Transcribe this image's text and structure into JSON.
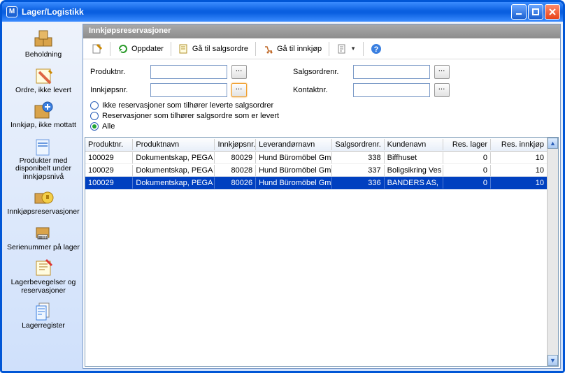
{
  "window": {
    "title": "Lager/Logistikk",
    "app_icon_letter": "M"
  },
  "sidebar": {
    "items": [
      {
        "label": "Beholdning"
      },
      {
        "label": "Ordre, ikke levert"
      },
      {
        "label": "Innkjøp, ikke mottatt"
      },
      {
        "label": "Produkter med disponibelt under innkjøpsnivå"
      },
      {
        "label": "Innkjøpsreservasjoner"
      },
      {
        "label": "Serienummer på lager"
      },
      {
        "label": "Lagerbevegelser og reservasjoner"
      },
      {
        "label": "Lagerregister"
      }
    ]
  },
  "panel": {
    "title": "Innkjøpsreservasjoner"
  },
  "toolbar": {
    "refresh_label": "Oppdater",
    "goto_salesorder_label": "Gå til salgsordre",
    "goto_purchase_label": "Gå til innkjøp"
  },
  "filters": {
    "produktnr_label": "Produktnr.",
    "innkjopsnr_label": "Innkjøpsnr.",
    "salgsordrenr_label": "Salgsordrenr.",
    "kontaktnr_label": "Kontaktnr.",
    "produktnr_value": "",
    "innkjopsnr_value": "",
    "salgsordrenr_value": "",
    "kontaktnr_value": "",
    "radio1": "Ikke reservasjoner som tilhører leverte salgsordrer",
    "radio2": "Reservasjoner som tilhører salgsordre som er levert",
    "radio3": "Alle",
    "selected_radio": 3
  },
  "grid": {
    "headers": {
      "produktnr": "Produktnr.",
      "produktnavn": "Produktnavn",
      "innkjopsnr": "Innkjøpsnr.",
      "leverandornavn": "Leverandørnavn",
      "salgsordrenr": "Salgsordrenr.",
      "kundenavn": "Kundenavn",
      "reslager": "Res. lager",
      "resinnkjop": "Res. innkjøp"
    },
    "rows": [
      {
        "produktnr": "100029",
        "produktnavn": "Dokumentskap, PEGA",
        "innkjopsnr": "80029",
        "leverandornavn": "Hund Büromöbel Gm",
        "salgsordrenr": "338",
        "kundenavn": "Biffhuset",
        "reslager": "0",
        "resinnkjop": "10",
        "selected": false
      },
      {
        "produktnr": "100029",
        "produktnavn": "Dokumentskap, PEGA",
        "innkjopsnr": "80028",
        "leverandornavn": "Hund Büromöbel Gm",
        "salgsordrenr": "337",
        "kundenavn": "Boligsikring Ves",
        "reslager": "0",
        "resinnkjop": "10",
        "selected": false
      },
      {
        "produktnr": "100029",
        "produktnavn": "Dokumentskap, PEGA",
        "innkjopsnr": "80026",
        "leverandornavn": "Hund Büromöbel Gm",
        "salgsordrenr": "336",
        "kundenavn": "BANDERS AS,",
        "reslager": "0",
        "resinnkjop": "10",
        "selected": true
      }
    ]
  }
}
